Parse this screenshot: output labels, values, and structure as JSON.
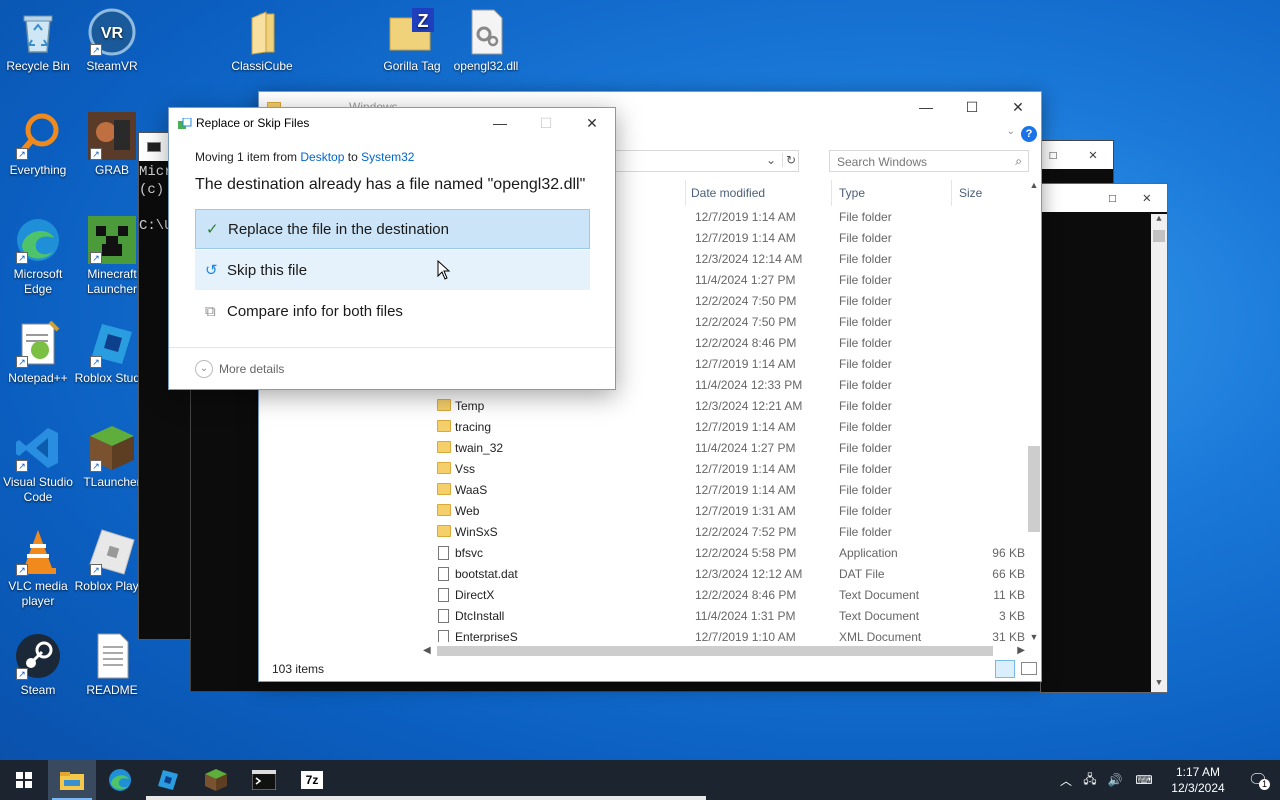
{
  "desktop": {
    "icons": [
      {
        "label": "Recycle Bin"
      },
      {
        "label": "SteamVR"
      },
      {
        "label": "ClassiCube"
      },
      {
        "label": "Gorilla Tag"
      },
      {
        "label": "opengl32.dll"
      },
      {
        "label": "Everything"
      },
      {
        "label": "GRAB"
      },
      {
        "label": "Microsoft Edge"
      },
      {
        "label": "Minecraft Launcher"
      },
      {
        "label": "Notepad++"
      },
      {
        "label": "Roblox Studio"
      },
      {
        "label": "Visual Studio Code"
      },
      {
        "label": "TLauncher"
      },
      {
        "label": "VLC media player"
      },
      {
        "label": "Roblox Player"
      },
      {
        "label": "Steam"
      },
      {
        "label": "README"
      }
    ]
  },
  "cmd": {
    "lines": [
      "Micr",
      "(c)",
      "",
      "C:\\U"
    ]
  },
  "explorer": {
    "title": "Windows",
    "search_placeholder": "Search Windows",
    "columns": {
      "date": "Date modified",
      "type": "Type",
      "size": "Size"
    },
    "rows": [
      {
        "name": "",
        "date": "12/7/2019 1:14 AM",
        "type": "File folder",
        "size": ""
      },
      {
        "name": "",
        "date": "12/7/2019 1:14 AM",
        "type": "File folder",
        "size": ""
      },
      {
        "name": "",
        "date": "12/3/2024 12:14 AM",
        "type": "File folder",
        "size": ""
      },
      {
        "name": "",
        "date": "11/4/2024 1:27 PM",
        "type": "File folder",
        "size": ""
      },
      {
        "name": "",
        "date": "12/2/2024 7:50 PM",
        "type": "File folder",
        "size": ""
      },
      {
        "name": "",
        "date": "12/2/2024 7:50 PM",
        "type": "File folder",
        "size": ""
      },
      {
        "name": "",
        "date": "12/2/2024 8:46 PM",
        "type": "File folder",
        "size": ""
      },
      {
        "name": "",
        "date": "12/7/2019 1:14 AM",
        "type": "File folder",
        "size": ""
      },
      {
        "name": "",
        "date": "11/4/2024 12:33 PM",
        "type": "File folder",
        "size": ""
      },
      {
        "name": "Temp",
        "date": "12/3/2024 12:21 AM",
        "type": "File folder",
        "size": ""
      },
      {
        "name": "tracing",
        "date": "12/7/2019 1:14 AM",
        "type": "File folder",
        "size": ""
      },
      {
        "name": "twain_32",
        "date": "11/4/2024 1:27 PM",
        "type": "File folder",
        "size": ""
      },
      {
        "name": "Vss",
        "date": "12/7/2019 1:14 AM",
        "type": "File folder",
        "size": ""
      },
      {
        "name": "WaaS",
        "date": "12/7/2019 1:14 AM",
        "type": "File folder",
        "size": ""
      },
      {
        "name": "Web",
        "date": "12/7/2019 1:31 AM",
        "type": "File folder",
        "size": ""
      },
      {
        "name": "WinSxS",
        "date": "12/2/2024 7:52 PM",
        "type": "File folder",
        "size": ""
      },
      {
        "name": "bfsvc",
        "date": "12/2/2024 5:58 PM",
        "type": "Application",
        "size": "96 KB"
      },
      {
        "name": "bootstat.dat",
        "date": "12/3/2024 12:12 AM",
        "type": "DAT File",
        "size": "66 KB"
      },
      {
        "name": "DirectX",
        "date": "12/2/2024 8:46 PM",
        "type": "Text Document",
        "size": "11 KB"
      },
      {
        "name": "DtcInstall",
        "date": "11/4/2024 1:31 PM",
        "type": "Text Document",
        "size": "3 KB"
      },
      {
        "name": "EnterpriseS",
        "date": "12/7/2019 1:10 AM",
        "type": "XML Document",
        "size": "31 KB"
      }
    ],
    "status": "103 items"
  },
  "dialog": {
    "title": "Replace or Skip Files",
    "moving_prefix": "Moving 1 item from",
    "source": "Desktop",
    "to_word": "to",
    "destination": "System32",
    "headline": "The destination already has a file named \"opengl32.dll\"",
    "option_replace": "Replace the file in the destination",
    "option_skip": "Skip this file",
    "option_compare": "Compare info for both files",
    "more_details": "More details"
  },
  "taskbar": {
    "time": "1:17 AM",
    "date": "12/3/2024",
    "notification_count": "1",
    "apps": [
      "file-explorer",
      "edge",
      "roblox-studio",
      "minecraft",
      "terminal",
      "7zip"
    ],
    "sevenzip_label": "7z"
  },
  "colors": {
    "accent": "#0066cc",
    "selected_option": "#cce4f7",
    "hover_option": "#e5f1fb"
  }
}
